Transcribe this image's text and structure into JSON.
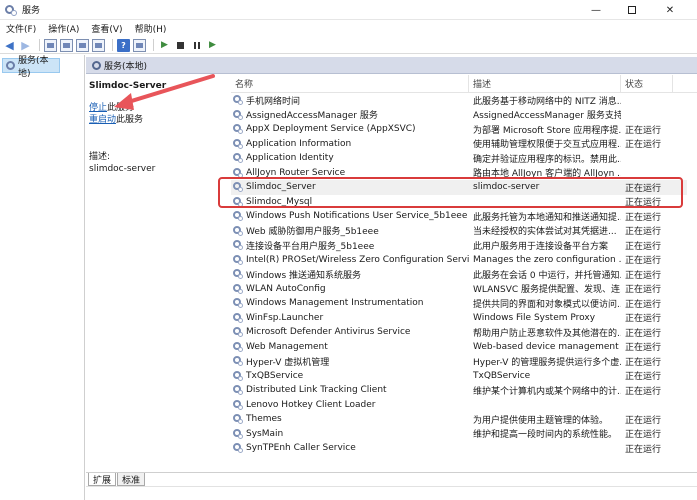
{
  "window": {
    "title": "服务",
    "minimize": "—",
    "close": "✕"
  },
  "menu": [
    {
      "label": "文件(F)"
    },
    {
      "label": "操作(A)"
    },
    {
      "label": "查看(V)"
    },
    {
      "label": "帮助(H)"
    }
  ],
  "toolbar": {
    "help_label": "?"
  },
  "tree": {
    "root_label": "服务(本地)"
  },
  "pane": {
    "header": "服务(本地)"
  },
  "details": {
    "service_name": "Slimdoc-Server",
    "stop_link": "停止",
    "stop_suffix": "此服务",
    "restart_link": "重启动",
    "restart_suffix": "此服务",
    "desc_label": "描述:",
    "desc_text": "slimdoc-server"
  },
  "table": {
    "headers": {
      "name": "名称",
      "desc": "描述",
      "status": "状态"
    },
    "rows": [
      {
        "name": "手机网络时间",
        "desc": "此服务基于移动网络中的 NITZ 消息...",
        "status": ""
      },
      {
        "name": "AssignedAccessManager 服务",
        "desc": "AssignedAccessManager 服务支持 ...",
        "status": ""
      },
      {
        "name": "AppX Deployment Service (AppXSVC)",
        "desc": "为部署 Microsoft Store 应用程序提...",
        "status": "正在运行"
      },
      {
        "name": "Application Information",
        "desc": "使用辅助管理权限便于交互式应用程...",
        "status": "正在运行"
      },
      {
        "name": "Application Identity",
        "desc": "确定并验证应用程序的标识。禁用此...",
        "status": ""
      },
      {
        "name": "AllJoyn Router Service",
        "desc": "路由本地 AllJoyn 客户端的 AllJoyn ...",
        "status": ""
      },
      {
        "name": "Slimdoc_Server",
        "desc": "slimdoc-server",
        "status": "正在运行"
      },
      {
        "name": "Slimdoc_Mysql",
        "desc": "",
        "status": "正在运行"
      },
      {
        "name": "Windows Push Notifications User Service_5b1eee",
        "desc": "此服务托管为本地通知和推送通知提...",
        "status": "正在运行"
      },
      {
        "name": "Web 威胁防御用户服务_5b1eee",
        "desc": "当未经授权的实体尝试对其凭据进...",
        "status": "正在运行"
      },
      {
        "name": "连接设备平台用户服务_5b1eee",
        "desc": "此用户服务用于连接设备平台方案",
        "status": "正在运行"
      },
      {
        "name": "Intel(R) PROSet/Wireless Zero Configuration Service",
        "desc": "Manages the zero configuration ...",
        "status": "正在运行"
      },
      {
        "name": "Windows 推送通知系统服务",
        "desc": "此服务在会话 0 中运行，并托管通知...",
        "status": "正在运行"
      },
      {
        "name": "WLAN AutoConfig",
        "desc": "WLANSVC 服务提供配置、发现、连...",
        "status": "正在运行"
      },
      {
        "name": "Windows Management Instrumentation",
        "desc": "提供共同的界面和对象模式以便访问...",
        "status": "正在运行"
      },
      {
        "name": "WinFsp.Launcher",
        "desc": "Windows File System Proxy",
        "status": "正在运行"
      },
      {
        "name": "Microsoft Defender Antivirus Service",
        "desc": "帮助用户防止恶意软件及其他潜在的...",
        "status": "正在运行"
      },
      {
        "name": "Web Management",
        "desc": "Web-based device management s...",
        "status": "正在运行"
      },
      {
        "name": "Hyper-V 虚拟机管理",
        "desc": "Hyper-V 的管理服务提供运行多个虚...",
        "status": "正在运行"
      },
      {
        "name": "TxQBService",
        "desc": "TxQBService",
        "status": "正在运行"
      },
      {
        "name": "Distributed Link Tracking Client",
        "desc": "维护某个计算机内或某个网络中的计...",
        "status": "正在运行"
      },
      {
        "name": "Lenovo Hotkey Client Loader",
        "desc": "",
        "status": ""
      },
      {
        "name": "Themes",
        "desc": "为用户提供使用主题管理的体验。",
        "status": "正在运行"
      },
      {
        "name": "SysMain",
        "desc": "维护和提高一段时间内的系统性能。",
        "status": "正在运行"
      },
      {
        "name": "SynTPEnh Caller Service",
        "desc": "",
        "status": "正在运行"
      }
    ]
  },
  "tabs": [
    {
      "label": "扩展"
    },
    {
      "label": "标准"
    }
  ],
  "colors": {
    "annotation": "#d93b3b",
    "link": "#1a5fb4"
  }
}
